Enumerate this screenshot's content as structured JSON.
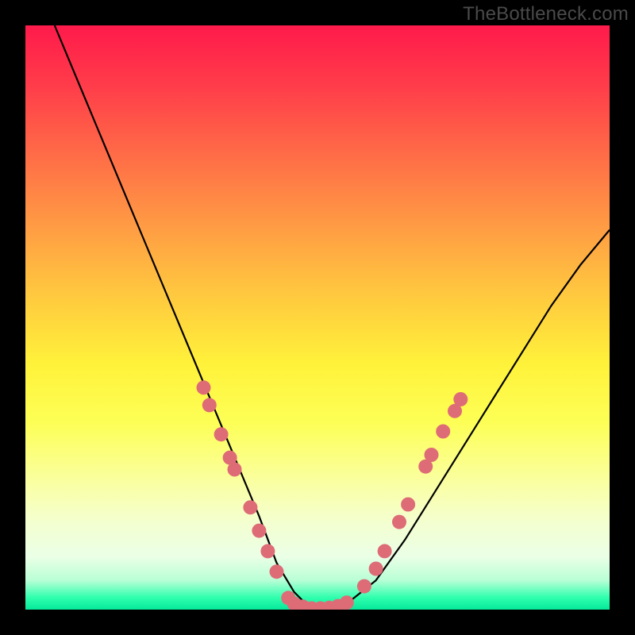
{
  "watermark": "TheBottleneck.com",
  "chart_data": {
    "type": "line",
    "title": "",
    "xlabel": "",
    "ylabel": "",
    "xlim": [
      0,
      100
    ],
    "ylim": [
      0,
      100
    ],
    "grid": false,
    "legend": false,
    "series": [
      {
        "name": "bottleneck-curve",
        "x": [
          5,
          10,
          15,
          20,
          25,
          30,
          35,
          40,
          43,
          46,
          48,
          50,
          52,
          55,
          60,
          65,
          70,
          75,
          80,
          85,
          90,
          95,
          100
        ],
        "values": [
          100,
          88,
          76,
          64,
          52,
          40,
          28,
          16,
          8,
          3,
          1,
          0,
          0,
          1,
          5,
          12,
          20,
          28,
          36,
          44,
          52,
          59,
          65
        ],
        "color": "#000000"
      }
    ],
    "markers": {
      "name": "data-points",
      "color": "#de6c77",
      "radius": 9,
      "points": [
        {
          "x": 30.5,
          "y": 38
        },
        {
          "x": 31.5,
          "y": 35
        },
        {
          "x": 33.5,
          "y": 30
        },
        {
          "x": 35.0,
          "y": 26
        },
        {
          "x": 35.8,
          "y": 24
        },
        {
          "x": 38.5,
          "y": 17.5
        },
        {
          "x": 40.0,
          "y": 13.5
        },
        {
          "x": 41.5,
          "y": 10
        },
        {
          "x": 43.0,
          "y": 6.5
        },
        {
          "x": 45.0,
          "y": 2
        },
        {
          "x": 46.0,
          "y": 1
        },
        {
          "x": 47.5,
          "y": 0.5
        },
        {
          "x": 49.0,
          "y": 0.2
        },
        {
          "x": 50.5,
          "y": 0.2
        },
        {
          "x": 52.0,
          "y": 0.3
        },
        {
          "x": 53.5,
          "y": 0.6
        },
        {
          "x": 55.0,
          "y": 1.2
        },
        {
          "x": 58.0,
          "y": 4
        },
        {
          "x": 60.0,
          "y": 7
        },
        {
          "x": 61.5,
          "y": 10
        },
        {
          "x": 64.0,
          "y": 15
        },
        {
          "x": 65.5,
          "y": 18
        },
        {
          "x": 68.5,
          "y": 24.5
        },
        {
          "x": 69.5,
          "y": 26.5
        },
        {
          "x": 71.5,
          "y": 30.5
        },
        {
          "x": 73.5,
          "y": 34
        },
        {
          "x": 74.5,
          "y": 36
        }
      ]
    },
    "background_gradient": {
      "type": "vertical",
      "stops": [
        {
          "pos": 0,
          "color": "#ff1a4b"
        },
        {
          "pos": 0.5,
          "color": "#fff23a"
        },
        {
          "pos": 0.85,
          "color": "#f4ffd0"
        },
        {
          "pos": 1.0,
          "color": "#06e89a"
        }
      ]
    }
  }
}
